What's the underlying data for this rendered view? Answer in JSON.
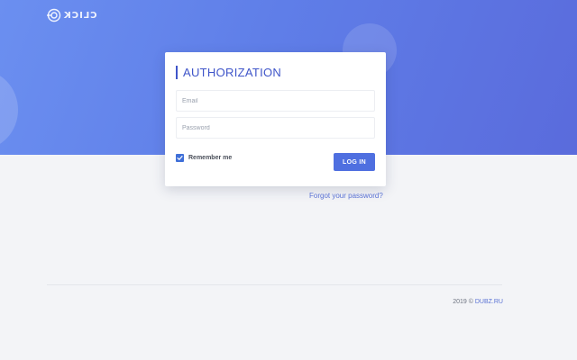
{
  "header": {
    "logo_text": "CLICK",
    "logo_icon": "target-icon"
  },
  "login": {
    "title": "AUTHORIZATION",
    "email_placeholder": "Email",
    "password_placeholder": "Password",
    "remember_label": "Remember me",
    "remember_checked": true,
    "login_button": "LOG IN",
    "forgot_link": "Forgot your password?"
  },
  "footer": {
    "copyright": "2019 ©",
    "site_link": "DUBZ.RU"
  },
  "colors": {
    "accent": "#4f6fe0",
    "title": "#3f55c9",
    "hero_start": "#6b8ff0",
    "hero_end": "#5a6bdc",
    "background": "#f3f4f7"
  }
}
